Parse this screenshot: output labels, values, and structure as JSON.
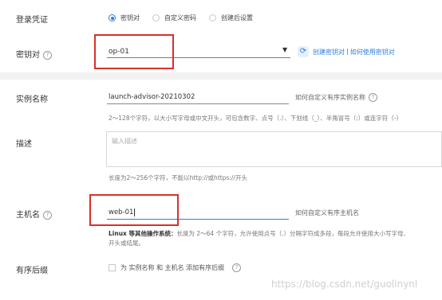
{
  "credential": {
    "label": "登录凭证",
    "options": [
      "密钥对",
      "自定义密码",
      "创建后设置"
    ],
    "selected": "密钥对"
  },
  "keypair": {
    "label": "密钥对",
    "value": "op-01",
    "refresh_icon": "refresh-icon",
    "link_create": "创建密钥对",
    "divider": "|",
    "link_howto": "如何使用密钥对"
  },
  "instance_name": {
    "label": "实例名称",
    "value": "launch-advisor-20210302",
    "help": "如何自定义有序实例名称",
    "hint": "2～128个字符，以大小写字母或中文开头，可包含数字、点号（.）、下划线（_）、半角冒号（:）或连字符（-）"
  },
  "description": {
    "label": "描述",
    "placeholder": "输入描述",
    "hint": "长度为2～256个字符，不能以http://或https://开头"
  },
  "hostname": {
    "label": "主机名",
    "value": "web-01",
    "help": "如何自定义有序主机名",
    "hint_bold": "Linux 等其他操作系统：",
    "hint": "长度为 2～64 个字符，允许使用点号（.）分隔字符成多段，每段允许使用大小写字母、",
    "hint2": "开头或结尾。"
  },
  "suffix": {
    "label": "有序后缀",
    "checkbox_label": "为 实例名称 和 主机名 添加有序后缀"
  },
  "watermark": "https://blog.csdn.net/guolinynl"
}
